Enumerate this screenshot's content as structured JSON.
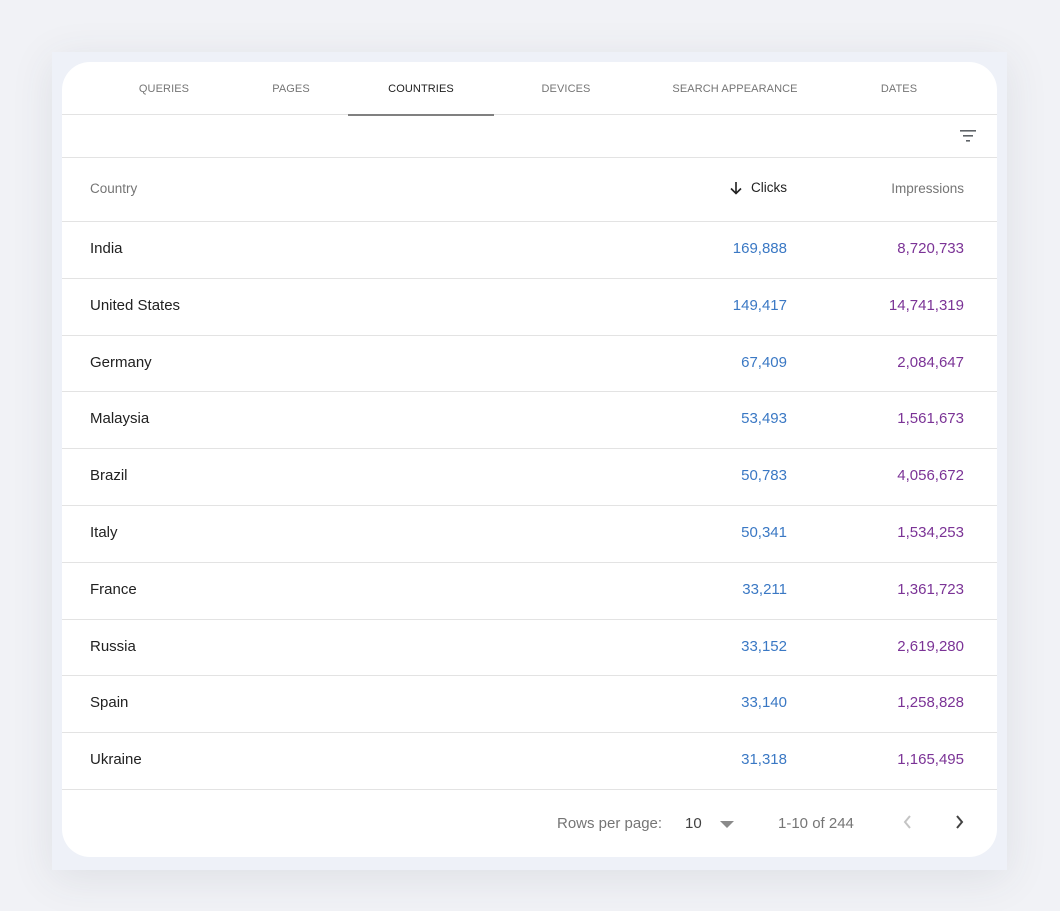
{
  "tabs": [
    {
      "label": "QUERIES",
      "active": false
    },
    {
      "label": "PAGES",
      "active": false
    },
    {
      "label": "COUNTRIES",
      "active": true
    },
    {
      "label": "DEVICES",
      "active": false
    },
    {
      "label": "SEARCH APPEARANCE",
      "active": false
    },
    {
      "label": "DATES",
      "active": false
    }
  ],
  "toolbar": {
    "filter_icon": "filter-list-icon"
  },
  "table": {
    "columns": {
      "country": "Country",
      "clicks": "Clicks",
      "impressions": "Impressions",
      "sort_icon": "arrow-down-icon",
      "sorted_by": "Clicks",
      "sort_direction": "descending"
    },
    "rows": [
      {
        "country": "India",
        "clicks": "169,888",
        "impressions": "8,720,733"
      },
      {
        "country": "United States",
        "clicks": "149,417",
        "impressions": "14,741,319"
      },
      {
        "country": "Germany",
        "clicks": "67,409",
        "impressions": "2,084,647"
      },
      {
        "country": "Malaysia",
        "clicks": "53,493",
        "impressions": "1,561,673"
      },
      {
        "country": "Brazil",
        "clicks": "50,783",
        "impressions": "4,056,672"
      },
      {
        "country": "Italy",
        "clicks": "50,341",
        "impressions": "1,534,253"
      },
      {
        "country": "France",
        "clicks": "33,211",
        "impressions": "1,361,723"
      },
      {
        "country": "Russia",
        "clicks": "33,152",
        "impressions": "2,619,280"
      },
      {
        "country": "Spain",
        "clicks": "33,140",
        "impressions": "1,258,828"
      },
      {
        "country": "Ukraine",
        "clicks": "31,318",
        "impressions": "1,165,495"
      }
    ]
  },
  "pagination": {
    "rows_per_page_label": "Rows per page:",
    "rows_per_page_value": "10",
    "range_text": "1-10 of 244",
    "prev_icon": "chevron-left-icon",
    "next_icon": "chevron-right-icon"
  },
  "colors": {
    "clicks": "#3a78c4",
    "impressions": "#7b3396",
    "active_tab_indicator": "#808080",
    "background": "#f1f2f6"
  }
}
